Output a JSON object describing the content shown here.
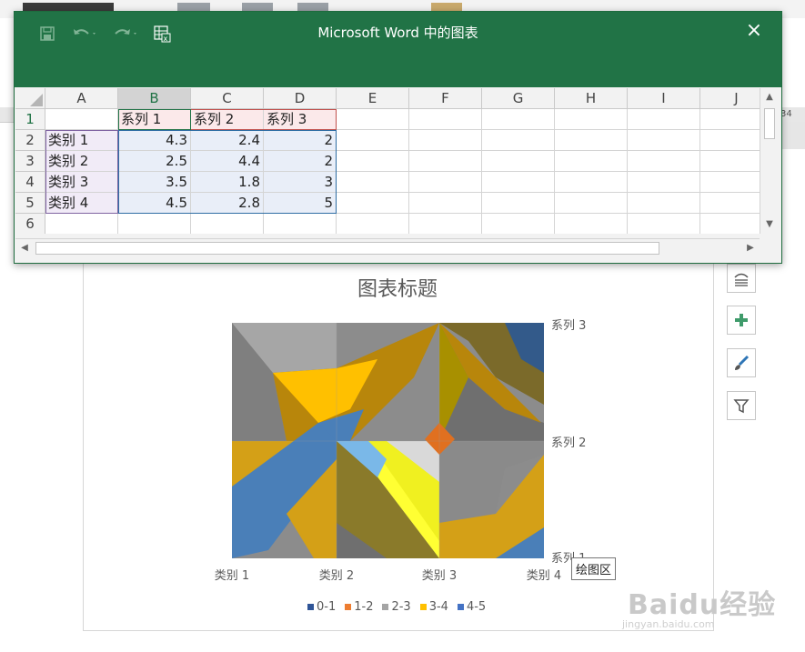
{
  "excel": {
    "title": "Microsoft Word 中的图表",
    "close_icon": "×",
    "columns": [
      "A",
      "B",
      "C",
      "D",
      "E",
      "F",
      "G",
      "H",
      "I",
      "J"
    ],
    "rows": [
      "1",
      "2",
      "3",
      "4",
      "5",
      "6"
    ],
    "data": [
      [
        "",
        "系列 1",
        "系列 2",
        "系列 3"
      ],
      [
        "类别 1",
        "4.3",
        "2.4",
        "2"
      ],
      [
        "类别 2",
        "2.5",
        "4.4",
        "2"
      ],
      [
        "类别 3",
        "3.5",
        "1.8",
        "3"
      ],
      [
        "类别 4",
        "4.5",
        "2.8",
        "5"
      ]
    ],
    "icons": [
      "save-icon",
      "undo-icon",
      "redo-icon",
      "edit-data-in-excel-icon"
    ]
  },
  "word": {
    "ruler_right_text": "34"
  },
  "chart": {
    "title": "图表标题",
    "tooltip": "绘图区",
    "side_buttons": [
      "layout-options-icon",
      "chart-elements-icon",
      "chart-styles-icon",
      "chart-filters-icon"
    ]
  },
  "chart_data": {
    "type": "surface",
    "title": "图表标题",
    "categories": [
      "类别 1",
      "类别 2",
      "类别 3",
      "类别 4"
    ],
    "series": [
      {
        "name": "系列 1",
        "values": [
          4.3,
          2.5,
          3.5,
          4.5
        ]
      },
      {
        "name": "系列 2",
        "values": [
          2.4,
          4.4,
          1.8,
          2.8
        ]
      },
      {
        "name": "系列 3",
        "values": [
          2,
          2,
          3,
          5
        ]
      }
    ],
    "legend": {
      "position": "bottom",
      "entries": [
        "0-1",
        "1-2",
        "2-3",
        "3-4",
        "4-5"
      ]
    },
    "band_colors": {
      "0-1": "#2f5597",
      "1-2": "#ed7d31",
      "2-3": "#a5a5a5",
      "3-4": "#ffc000",
      "4-5": "#4472c4"
    }
  },
  "watermark": {
    "text": "Baidu经验",
    "sub": "jingyan.baidu.com"
  }
}
